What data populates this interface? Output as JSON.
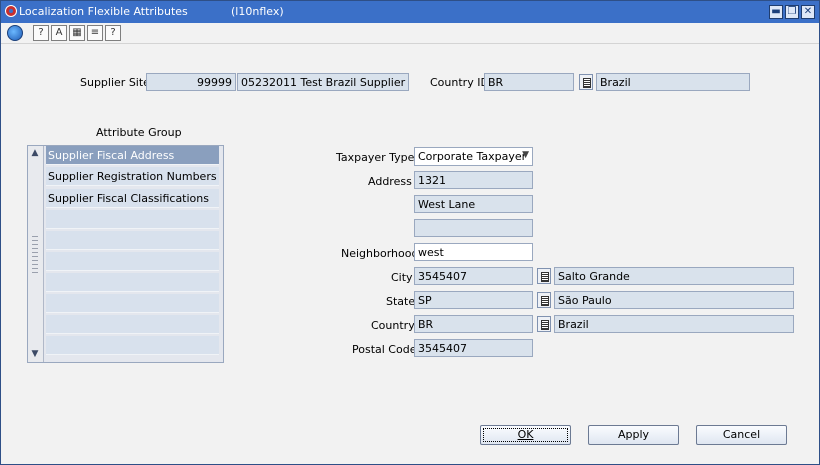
{
  "window": {
    "title": "Localization Flexible Attributes",
    "code": "(l10nflex)",
    "minimize": "▬",
    "restore": "❐",
    "close": "✕"
  },
  "toolbar": {
    "icons": [
      "globe-icon",
      "help-icon",
      "spell-icon",
      "calendar-icon",
      "notes-icon",
      "question-icon"
    ],
    "glyphs": [
      "",
      "?",
      "A",
      "▦",
      "≡",
      "?"
    ]
  },
  "header": {
    "supplier_site_label": "Supplier Site",
    "supplier_site_id": "99999",
    "supplier_site_name": "05232011 Test Brazil Supplier",
    "country_id_label": "Country ID",
    "country_id": "BR",
    "country_name": "Brazil"
  },
  "attribute_group": {
    "title": "Attribute Group",
    "items": [
      "Supplier Fiscal Address",
      "Supplier Registration Numbers",
      "Supplier Fiscal Classifications",
      "",
      "",
      "",
      "",
      "",
      "",
      ""
    ],
    "selected_index": 0
  },
  "form": {
    "taxpayer_type_label": "Taxpayer Type",
    "taxpayer_type": "Corporate Taxpayer",
    "address_label": "Address",
    "address1": "1321",
    "address2": "West Lane",
    "address3": "",
    "neighborhood_label": "Neighborhood",
    "neighborhood": "west",
    "city_label": "City",
    "city_code": "3545407",
    "city_name": "Salto Grande",
    "state_label": "State",
    "state_code": "SP",
    "state_name": "São Paulo",
    "country_label": "Country",
    "country_code": "BR",
    "country_name": "Brazil",
    "postal_code_label": "Postal Code",
    "postal_code": "3545407"
  },
  "buttons": {
    "ok": "OK",
    "apply": "Apply",
    "cancel": "Cancel"
  }
}
